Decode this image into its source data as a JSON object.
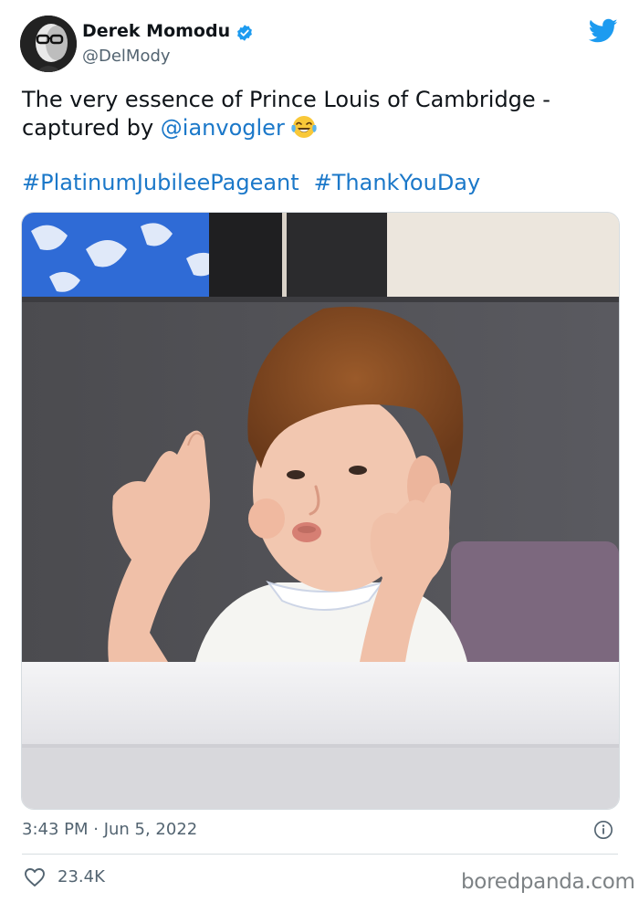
{
  "tweet": {
    "author_name": "Derek Momodu",
    "author_handle": "@DelMody",
    "text_line1": "The very essence of Prince Louis of Cambridge -",
    "text_line2_prefix": "captured by ",
    "mention": "@ianvogler",
    "emoji": "😂",
    "hashtags": [
      "#PlatinumJubileePageant",
      "#ThankYouDay"
    ],
    "timestamp": "3:43 PM · Jun 5, 2022",
    "like_count": "23.4K"
  },
  "icons": {
    "verified": "verified-badge-icon",
    "platform": "twitter-bird-icon",
    "info": "info-icon",
    "like": "heart-icon"
  },
  "watermark": "boredpanda.com",
  "colors": {
    "link": "#1b78c9",
    "verified": "#1d9bf0",
    "text": "#0f1419",
    "muted": "#536471"
  }
}
